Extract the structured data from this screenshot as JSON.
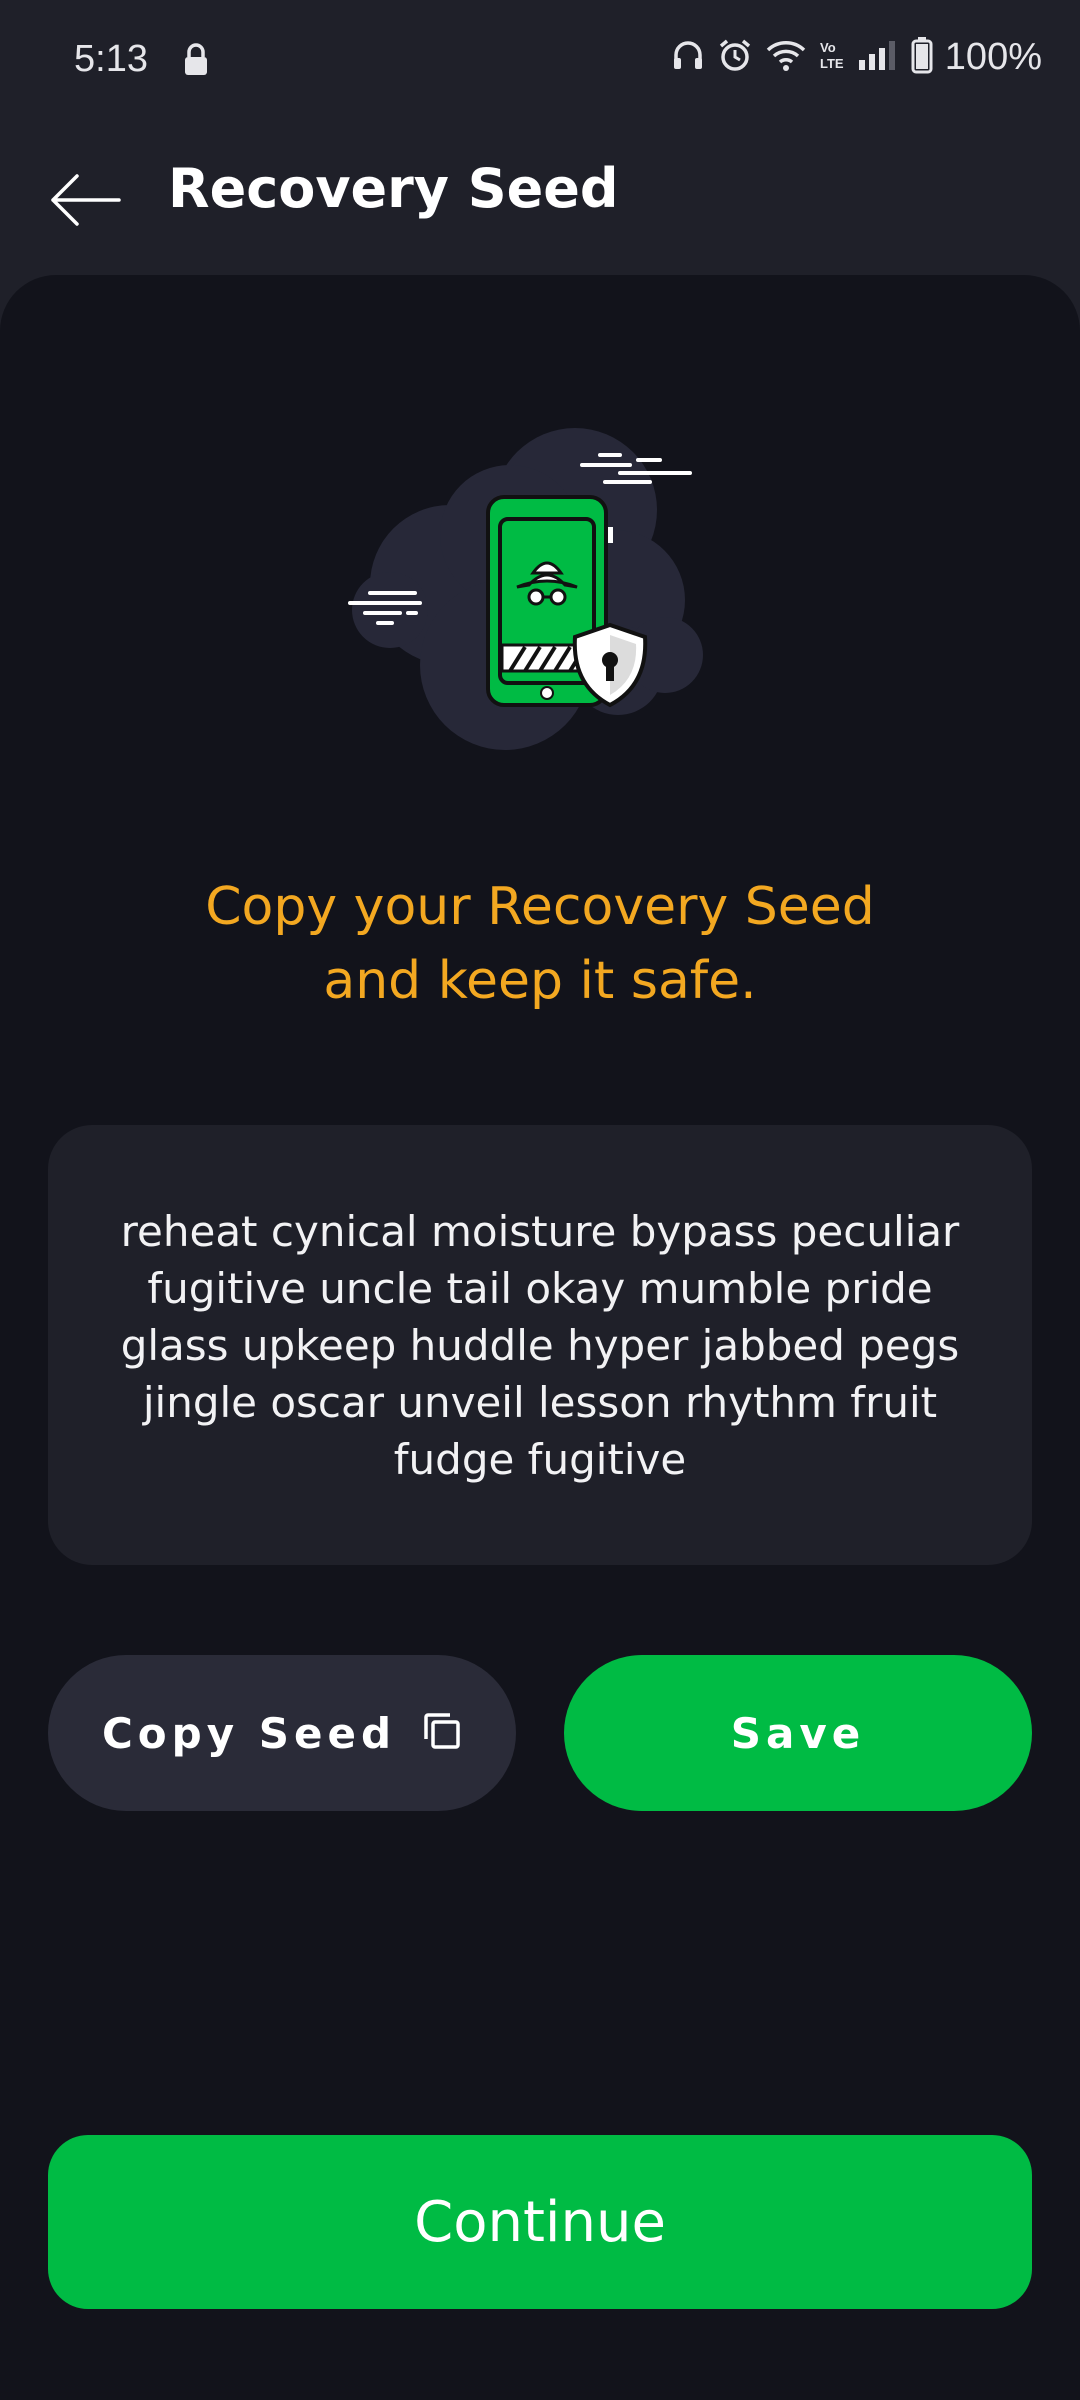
{
  "status_bar": {
    "time": "5:13",
    "battery": "100%",
    "icons": [
      "lock-icon",
      "headphones-icon",
      "alarm-icon",
      "wifi-icon",
      "volte-icon",
      "signal-icon",
      "battery-icon"
    ]
  },
  "app_bar": {
    "back_icon": "arrow-left-icon",
    "title": "Recovery Seed"
  },
  "illustration": {
    "icon": "phone-spy-shield-illustration"
  },
  "headline": {
    "line1": "Copy your Recovery Seed",
    "line2": "and keep it safe."
  },
  "seed": {
    "phrase": "reheat cynical moisture bypass peculiar fugitive uncle tail okay mumble pride glass upkeep huddle hyper jabbed pegs jingle oscar unveil lesson rhythm fruit fudge fugitive"
  },
  "actions": {
    "copy_label": "Copy Seed",
    "copy_icon": "copy-icon",
    "save_label": "Save"
  },
  "footer": {
    "continue_label": "Continue"
  },
  "colors": {
    "accent_green": "#00bb44",
    "headline_orange": "#f3a821",
    "background": "#12131b",
    "surface": "#1f2029"
  }
}
